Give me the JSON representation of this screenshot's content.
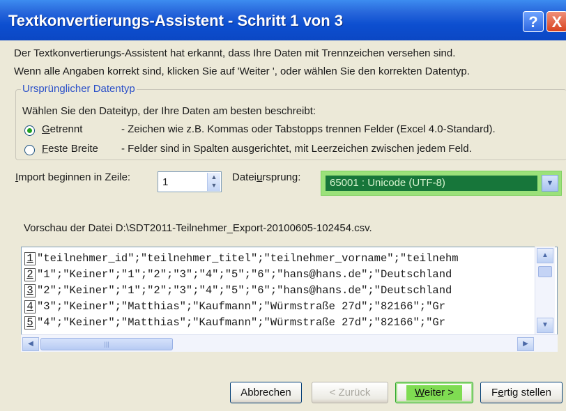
{
  "window": {
    "title": "Textkonvertierungs-Assistent - Schritt 1 von 3",
    "help_glyph": "?",
    "close_glyph": "X"
  },
  "intro": {
    "line1": "Der Textkonvertierungs-Assistent hat erkannt, dass Ihre Daten mit Trennzeichen versehen sind.",
    "line2": "Wenn alle Angaben korrekt sind, klicken Sie auf 'Weiter ', oder wählen Sie den korrekten Datentyp."
  },
  "datatype_group": {
    "legend": "Ursprünglicher Datentyp",
    "prompt": "Wählen Sie den Dateityp, der Ihre Daten am besten beschreibt:",
    "options": [
      {
        "label_first": "G",
        "label_rest": "etrennt",
        "description": "- Zeichen wie z.B. Kommas oder Tabstopps trennen Felder (Excel 4.0-Standard).",
        "selected": true
      },
      {
        "label_first": "F",
        "label_rest": "este Breite",
        "description": "- Felder sind in Spalten ausgerichtet, mit Leerzeichen zwischen jedem Feld.",
        "selected": false
      }
    ]
  },
  "import_row": {
    "label_first": "I",
    "label_rest": "mport beginnen in Zeile:",
    "value": "1"
  },
  "origin": {
    "label_pre": "Datei",
    "label_u": "u",
    "label_post": "rsprung:",
    "value": "65001 : Unicode (UTF-8)"
  },
  "preview": {
    "label": "Vorschau der Datei D:\\SDT2011-Teilnehmer_Export-20100605-102454.csv.",
    "rows": [
      {
        "num": "1",
        "text": "\"teilnehmer_id\";\"teilnehmer_titel\";\"teilnehmer_vorname\";\"teilnehm"
      },
      {
        "num": "2",
        "text": "\"1\";\"Keiner\";\"1\";\"2\";\"3\";\"4\";\"5\";\"6\";\"hans@hans.de\";\"Deutschland"
      },
      {
        "num": "3",
        "text": "\"2\";\"Keiner\";\"1\";\"2\";\"3\";\"4\";\"5\";\"6\";\"hans@hans.de\";\"Deutschland"
      },
      {
        "num": "4",
        "text": "\"3\";\"Keiner\";\"Matthias\";\"Kaufmann\";\"Würmstraße 27d\";\"82166\";\"Gr"
      },
      {
        "num": "5",
        "text": "\"4\";\"Keiner\";\"Matthias\";\"Kaufmann\";\"Würmstraße 27d\";\"82166\";\"Gr"
      }
    ]
  },
  "buttons": {
    "cancel": "Abbrechen",
    "back": "< Zurück",
    "next_u": "W",
    "next_rest": "eiter >",
    "finish_pre": "F",
    "finish_u": "e",
    "finish_post": "rtig stellen"
  }
}
